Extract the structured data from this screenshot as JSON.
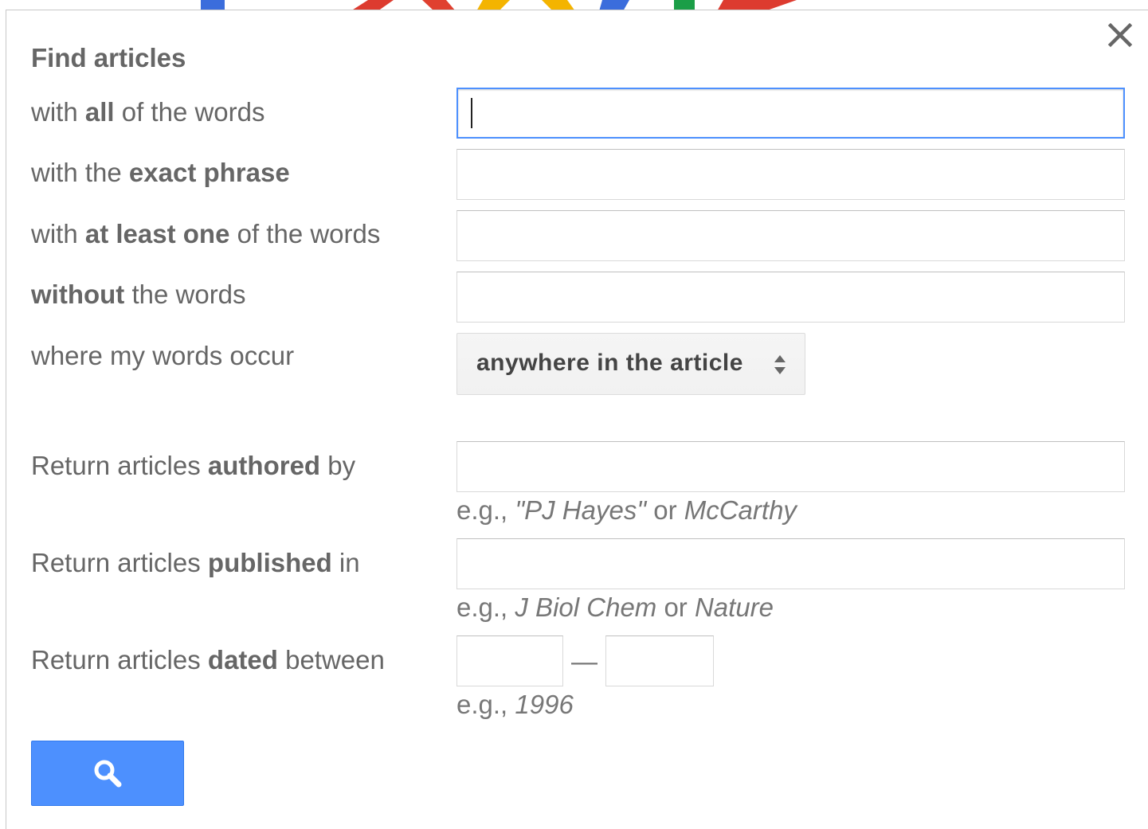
{
  "dialog": {
    "title": "Find articles",
    "close_icon": "close-icon"
  },
  "rows": {
    "all_words": {
      "pre": "with ",
      "bold": "all",
      "post": " of the words",
      "value": ""
    },
    "exact_phrase": {
      "pre": "with the ",
      "bold": "exact phrase",
      "post": "",
      "value": ""
    },
    "at_least_one": {
      "pre": "with ",
      "bold": "at least one",
      "post": " of the words",
      "value": ""
    },
    "without": {
      "pre": "",
      "bold": "without",
      "post": " the words",
      "value": ""
    },
    "occur": {
      "label": "where my words occur",
      "selected": "anywhere in the article"
    },
    "authored": {
      "pre": "Return articles ",
      "bold": "authored",
      "post": " by",
      "value": "",
      "hint_pre": "e.g., ",
      "hint_i1": "\"PJ Hayes\"",
      "hint_mid": " or ",
      "hint_i2": "McCarthy"
    },
    "published": {
      "pre": "Return articles ",
      "bold": "published",
      "post": " in",
      "value": "",
      "hint_pre": "e.g., ",
      "hint_i1": "J Biol Chem",
      "hint_mid": " or ",
      "hint_i2": "Nature"
    },
    "dated": {
      "pre": "Return articles ",
      "bold": "dated",
      "post": " between",
      "from": "",
      "to": "",
      "dash": "—",
      "hint_pre": "e.g., ",
      "hint_i1": "1996"
    }
  },
  "search_button": {
    "icon": "search-icon"
  },
  "colors": {
    "accent_blue": "#4d90fe",
    "label_gray": "#666666",
    "hint_gray": "#777777"
  }
}
